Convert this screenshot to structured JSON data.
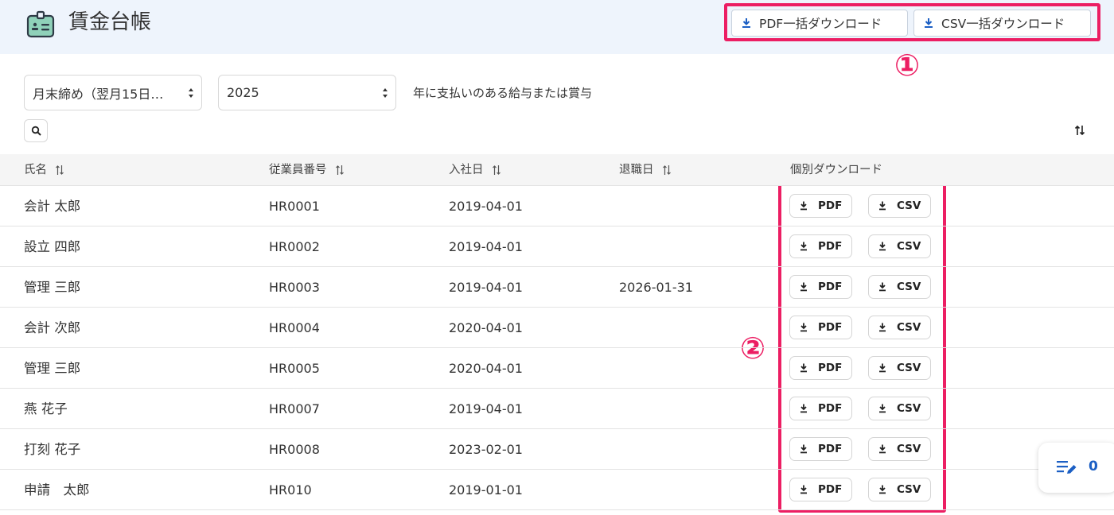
{
  "header": {
    "title": "賃金台帳",
    "icon": "id-badge-icon",
    "pdf_all_label": "PDF一括ダウンロード",
    "csv_all_label": "CSV一括ダウンロード"
  },
  "annotations": {
    "callout_1": "①",
    "callout_2": "②",
    "color": "#ec1e63"
  },
  "filters": {
    "period_value": "月末締め（翌月15日…",
    "year_value": "2025",
    "note": "年に支払いのある給与または賞与"
  },
  "table": {
    "columns": {
      "name": "氏名",
      "employee_id": "従業員番号",
      "join_date": "入社日",
      "leave_date": "退職日",
      "download": "個別ダウンロード"
    },
    "pdf_label": "PDF",
    "csv_label": "CSV",
    "rows": [
      {
        "name": "会計 太郎",
        "employee_id": "HR0001",
        "join_date": "2019-04-01",
        "leave_date": ""
      },
      {
        "name": "設立 四郎",
        "employee_id": "HR0002",
        "join_date": "2019-04-01",
        "leave_date": ""
      },
      {
        "name": "管理 三郎",
        "employee_id": "HR0003",
        "join_date": "2019-04-01",
        "leave_date": "2026-01-31"
      },
      {
        "name": "会計 次郎",
        "employee_id": "HR0004",
        "join_date": "2020-04-01",
        "leave_date": ""
      },
      {
        "name": "管理 三郎",
        "employee_id": "HR0005",
        "join_date": "2020-04-01",
        "leave_date": ""
      },
      {
        "name": "燕 花子",
        "employee_id": "HR0007",
        "join_date": "2019-04-01",
        "leave_date": ""
      },
      {
        "name": "打刻 花子",
        "employee_id": "HR0008",
        "join_date": "2023-02-01",
        "leave_date": ""
      },
      {
        "name": "申請　太郎",
        "employee_id": "HR010",
        "join_date": "2019-01-01",
        "leave_date": ""
      }
    ]
  },
  "float_counter": {
    "count": "0",
    "icon": "edit-list-icon"
  },
  "colors": {
    "accent": "#1c5fc4",
    "header_bg": "#eef4fc"
  }
}
